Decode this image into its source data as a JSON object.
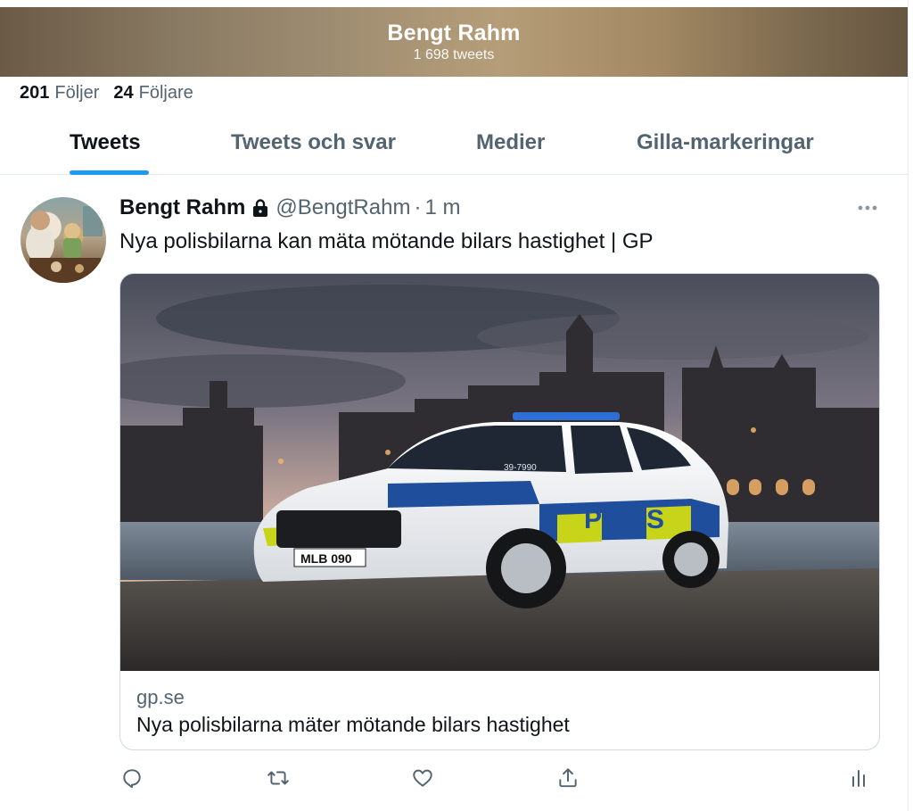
{
  "profile": {
    "display_name": "Bengt Rahm",
    "tweet_count": "1 698 tweets",
    "following_count": "201",
    "following_label": "Följer",
    "followers_count": "24",
    "followers_label": "Följare"
  },
  "tabs": [
    {
      "label": "Tweets",
      "active": true
    },
    {
      "label": "Tweets och svar",
      "active": false
    },
    {
      "label": "Medier",
      "active": false
    },
    {
      "label": "Gilla-markeringar",
      "active": false
    }
  ],
  "tweet": {
    "display_name": "Bengt Rahm",
    "handle": "@BengtRahm",
    "separator": "·",
    "time": "1 m",
    "text": "Nya polisbilarna kan mäta mötande bilars hastighet | GP",
    "more_icon": "more-horizontal-icon",
    "card": {
      "domain": "gp.se",
      "title": "Nya polisbilarna mäter mötande bilars hastighet",
      "image_car_text": "POLIS",
      "image_plate": "MLB 090",
      "image_roof_number": "39-7990"
    },
    "actions": [
      "reply-icon",
      "retweet-icon",
      "like-icon",
      "share-icon",
      "analytics-icon"
    ]
  },
  "colors": {
    "accent": "#1d9bf0",
    "text_primary": "#0f1419",
    "text_secondary": "#536471",
    "border": "#cfd9de"
  }
}
